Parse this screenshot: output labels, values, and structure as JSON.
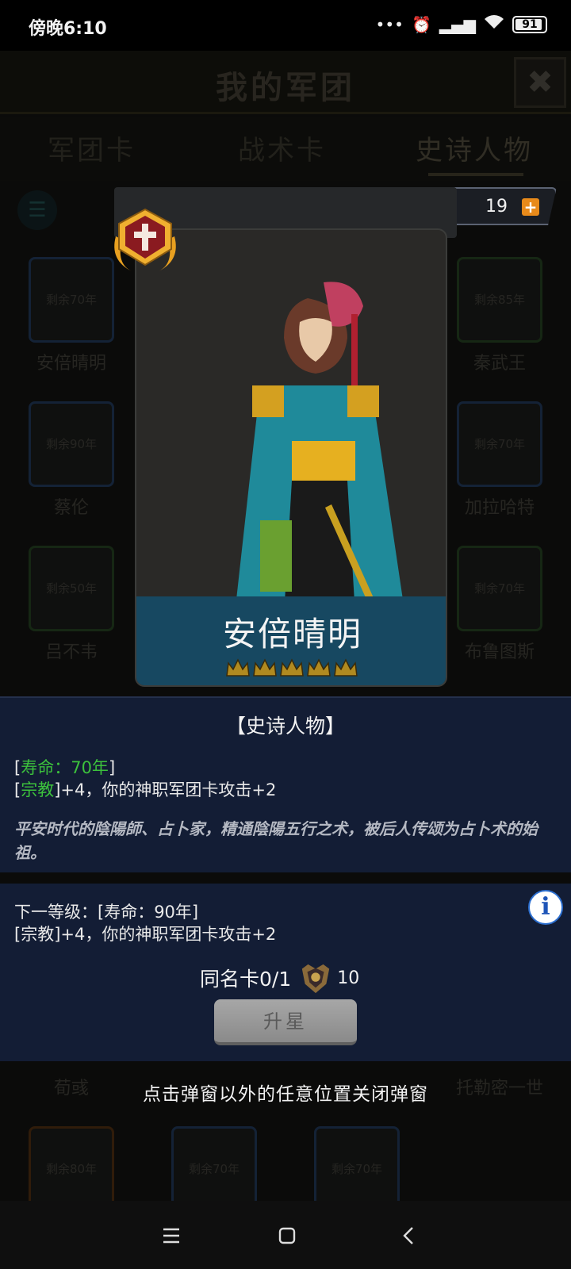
{
  "status_bar": {
    "time": "傍晚6:10",
    "battery": "91",
    "icons": [
      "dots-icon",
      "alarm-icon",
      "signal-hd-icon",
      "wifi-icon",
      "battery-icon"
    ]
  },
  "background": {
    "title": "我的军团",
    "close_label": "✖",
    "tabs": [
      "军团卡",
      "战术卡",
      "史诗人物"
    ],
    "cards": [
      {
        "remaining": "剩余70年",
        "name": "安倍晴明"
      },
      {
        "remaining": "剩余85年",
        "name": "秦武王"
      },
      {
        "remaining": "剩余90年",
        "name": "蔡伦"
      },
      {
        "remaining": "剩余70年",
        "name": "加拉哈特"
      },
      {
        "remaining": "剩余50年",
        "name": "吕不韦"
      },
      {
        "remaining": "剩余70年",
        "name": "布鲁图斯"
      },
      {
        "remaining": "",
        "name": "荀彧"
      },
      {
        "remaining": "",
        "name": "托勒密一世"
      },
      {
        "remaining": "剩余80年",
        "name": ""
      },
      {
        "remaining": "剩余70年",
        "name": ""
      },
      {
        "remaining": "剩余70年",
        "name": ""
      }
    ]
  },
  "resource": {
    "count": "19",
    "plus": "+"
  },
  "hero": {
    "name": "安倍晴明",
    "stars": 5
  },
  "info": {
    "heading": "【史诗人物】",
    "lifespan_open": "[",
    "lifespan": "寿命：70年",
    "lifespan_close": "]",
    "religion_open": "[",
    "religion": "宗教",
    "religion_effect": "]+4，你的神职军团卡攻击+2",
    "description": "平安时代的陰陽師、占卜家，精通陰陽五行之术，被后人传颂为占卜术的始祖。",
    "next_level": "下一等级：[寿命：90年]",
    "next_effect": "[宗教]+4，你的神职军团卡攻击+2",
    "info_icon": "i",
    "same_card_label": "同名卡0/1",
    "same_card_cost": "10",
    "upgrade_label": "升星",
    "dismiss_hint": "点击弹窗以外的任意位置关闭弹窗"
  },
  "colors": {
    "panel": "#131d35",
    "name_band": "#174861",
    "lifespan_green": "#3cc13c",
    "plus_orange": "#e88a1a"
  }
}
